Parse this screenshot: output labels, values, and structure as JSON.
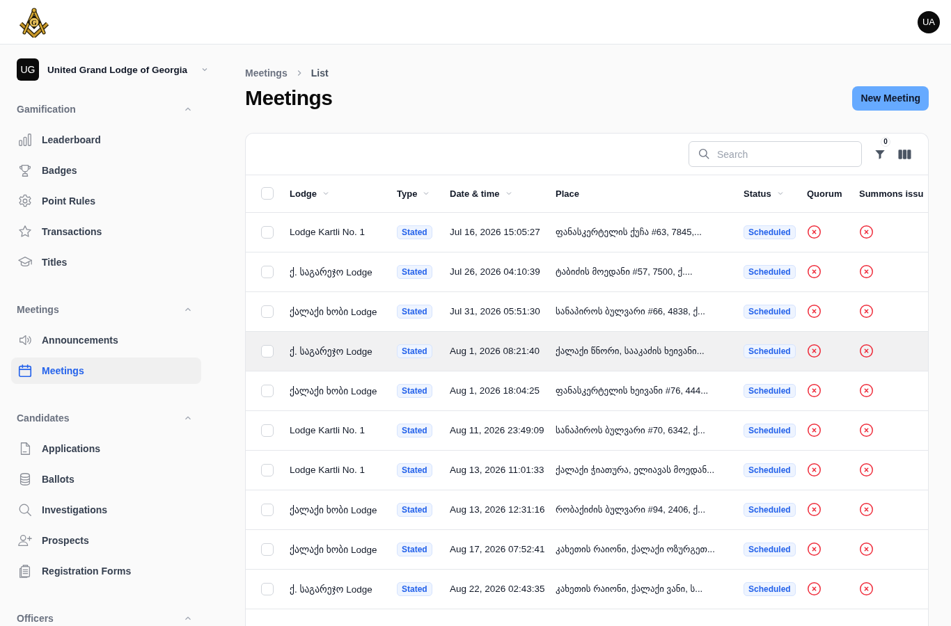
{
  "header": {
    "logo_letter": "G",
    "avatar": "UA"
  },
  "sidebar": {
    "org": {
      "initials": "UG",
      "name": "United Grand Lodge of Georgia"
    },
    "sections": [
      {
        "title": "Gamification",
        "expanded": true,
        "items": [
          {
            "label": "Leaderboard",
            "selected": false
          },
          {
            "label": "Badges",
            "selected": false
          },
          {
            "label": "Point Rules",
            "selected": false
          },
          {
            "label": "Transactions",
            "selected": false
          },
          {
            "label": "Titles",
            "selected": false
          }
        ]
      },
      {
        "title": "Meetings",
        "expanded": true,
        "items": [
          {
            "label": "Announcements",
            "selected": false
          },
          {
            "label": "Meetings",
            "selected": true
          }
        ]
      },
      {
        "title": "Candidates",
        "expanded": true,
        "items": [
          {
            "label": "Applications",
            "selected": false
          },
          {
            "label": "Ballots",
            "selected": false
          },
          {
            "label": "Investigations",
            "selected": false
          },
          {
            "label": "Prospects",
            "selected": false
          },
          {
            "label": "Registration Forms",
            "selected": false
          }
        ]
      },
      {
        "title": "Officers",
        "expanded": true
      }
    ]
  },
  "breadcrumb": [
    "Meetings",
    "List"
  ],
  "page_title": "Meetings",
  "primary_button": "New Meeting",
  "toolbar": {
    "search": {
      "placeholder": "Search"
    },
    "filter_count": "0"
  },
  "table": {
    "select_all": {
      "checked": false
    },
    "columns": [
      {
        "label": "Lodge",
        "kind": "sortable"
      },
      {
        "label": "Type",
        "kind": "sortable"
      },
      {
        "label": "Date & time",
        "kind": "sortable"
      },
      {
        "label": "Place",
        "kind": "plain"
      },
      {
        "label": "Status",
        "kind": "sortable"
      },
      {
        "label": "Quorum",
        "kind": "plain"
      },
      {
        "label": "Summons issu",
        "kind": "plain"
      }
    ],
    "rows": [
      {
        "selected": false,
        "highlighted": false,
        "lodge": "Lodge Kartli No. 1",
        "type": "Stated",
        "date_time": "Jul 16, 2026 15:05:27",
        "place": "ფანასკერტელის ქუჩა #63, 7845,...",
        "status": "Scheduled",
        "quorum": false,
        "summons_issued": false
      },
      {
        "selected": false,
        "highlighted": false,
        "lodge": "ქ. საგარეჯო Lodge",
        "type": "Stated",
        "date_time": "Jul 26, 2026 04:10:39",
        "place": "ტაბიძის მოედანი #57, 7500, ქ....",
        "status": "Scheduled",
        "quorum": false,
        "summons_issued": false
      },
      {
        "selected": false,
        "highlighted": false,
        "lodge": "ქალაქი ხობი Lodge",
        "type": "Stated",
        "date_time": "Jul 31, 2026 05:51:30",
        "place": "სანაპიროს ბულვარი #66, 4838, ქ...",
        "status": "Scheduled",
        "quorum": false,
        "summons_issued": false
      },
      {
        "selected": false,
        "highlighted": true,
        "lodge": "ქ. საგარეჯო Lodge",
        "type": "Stated",
        "date_time": "Aug 1, 2026 08:21:40",
        "place": "ქალაქი წნორი, სააკაძის ხეივანი...",
        "status": "Scheduled",
        "quorum": false,
        "summons_issued": false
      },
      {
        "selected": false,
        "highlighted": false,
        "lodge": "ქალაქი ხობი Lodge",
        "type": "Stated",
        "date_time": "Aug 1, 2026 18:04:25",
        "place": "ფანასკერტელის ხეივანი #76, 444...",
        "status": "Scheduled",
        "quorum": false,
        "summons_issued": false
      },
      {
        "selected": false,
        "highlighted": false,
        "lodge": "Lodge Kartli No. 1",
        "type": "Stated",
        "date_time": "Aug 11, 2026 23:49:09",
        "place": "სანაპიროს ბულვარი #70, 6342, ქ...",
        "status": "Scheduled",
        "quorum": false,
        "summons_issued": false
      },
      {
        "selected": false,
        "highlighted": false,
        "lodge": "Lodge Kartli No. 1",
        "type": "Stated",
        "date_time": "Aug 13, 2026 11:01:33",
        "place": "ქალაქი ჭიათურა, ელიავას მოედან...",
        "status": "Scheduled",
        "quorum": false,
        "summons_issued": false
      },
      {
        "selected": false,
        "highlighted": false,
        "lodge": "ქალაქი ხობი Lodge",
        "type": "Stated",
        "date_time": "Aug 13, 2026 12:31:16",
        "place": "რობაქიძის ბულვარი #94, 2406, ქ...",
        "status": "Scheduled",
        "quorum": false,
        "summons_issued": false
      },
      {
        "selected": false,
        "highlighted": false,
        "lodge": "ქალაქი ხობი Lodge",
        "type": "Stated",
        "date_time": "Aug 17, 2026 07:52:41",
        "place": "კახეთის რაიონი, ქალაქი ოზურგეთ...",
        "status": "Scheduled",
        "quorum": false,
        "summons_issued": false
      },
      {
        "selected": false,
        "highlighted": false,
        "lodge": "ქ. საგარეჯო Lodge",
        "type": "Stated",
        "date_time": "Aug 22, 2026 02:43:35",
        "place": "კახეთის რაიონი, ქალაქი ვანი, ს...",
        "status": "Scheduled",
        "quorum": false,
        "summons_issued": false
      }
    ]
  }
}
